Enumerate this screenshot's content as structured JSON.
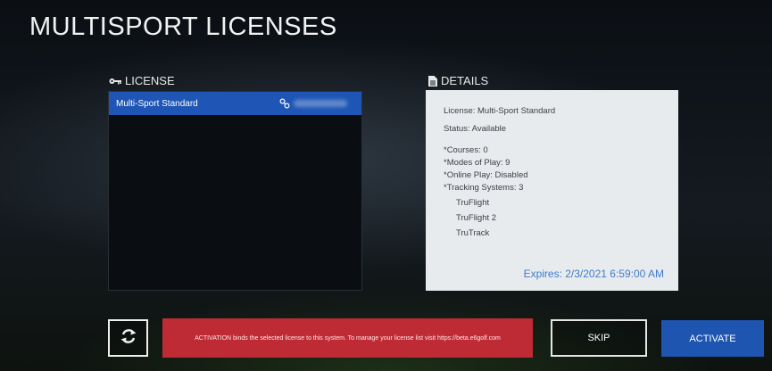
{
  "page": {
    "title": "MULTISPORT LICENSES"
  },
  "license_panel": {
    "label": "LICENSE",
    "items": [
      {
        "name": "Multi-Sport Standard",
        "selected": true
      }
    ]
  },
  "details_panel": {
    "label": "DETAILS",
    "license": "License: Multi-Sport Standard",
    "status": "Status: Available",
    "courses": "*Courses: 0",
    "modes": "*Modes of Play: 9",
    "online": "*Online Play: Disabled",
    "tracking": "*Tracking Systems: 3",
    "tracking_systems": [
      "TruFlight",
      "TruFlight 2",
      "TruTrack"
    ],
    "expires": "Expires: 2/3/2021 6:59:00 AM"
  },
  "footer": {
    "activation_note": "ACTIVATION binds the selected license to this system. To manage your license list visit https://beta.e6golf.com",
    "skip_label": "SKIP",
    "activate_label": "ACTIVATE"
  },
  "colors": {
    "selected_row": "#1f56b5",
    "banner": "#bf2b34",
    "activate": "#1e55b1",
    "expires_text": "#3f7cc9"
  },
  "icons": {
    "license": "key-icon",
    "details": "document-icon",
    "row": "link-icon",
    "refresh": "refresh-icon"
  }
}
